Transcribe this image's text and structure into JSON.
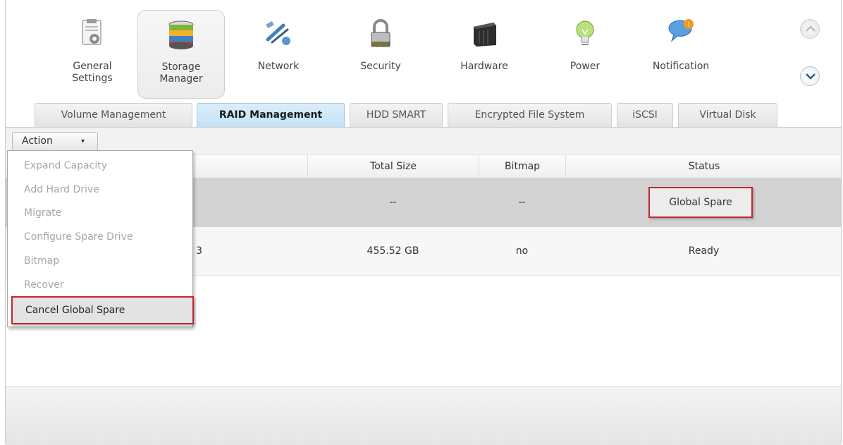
{
  "toolbar": {
    "items": [
      {
        "line1": "General",
        "line2": "Settings",
        "icon": "general-settings-icon"
      },
      {
        "line1": "Storage",
        "line2": "Manager",
        "icon": "storage-manager-icon"
      },
      {
        "line1": "Network",
        "line2": "",
        "icon": "network-icon"
      },
      {
        "line1": "Security",
        "line2": "",
        "icon": "security-lock-icon"
      },
      {
        "line1": "Hardware",
        "line2": "",
        "icon": "hardware-icon"
      },
      {
        "line1": "Power",
        "line2": "",
        "icon": "power-bulb-icon"
      },
      {
        "line1": "Notification",
        "line2": "",
        "icon": "notification-icon"
      }
    ],
    "active_index": 1
  },
  "tabs": [
    {
      "label": "Volume Management"
    },
    {
      "label": "RAID Management"
    },
    {
      "label": "HDD SMART"
    },
    {
      "label": "Encrypted File System"
    },
    {
      "label": "iSCSI"
    },
    {
      "label": "Virtual Disk"
    }
  ],
  "active_tab_index": 1,
  "action": {
    "label": "Action",
    "caret": "▾"
  },
  "table": {
    "headers": [
      "Total Size",
      "Bitmap",
      "Status"
    ],
    "rows": [
      {
        "name": "",
        "total_size": "--",
        "bitmap": "--",
        "status": "Global Spare"
      },
      {
        "name": "3",
        "total_size": "455.52 GB",
        "bitmap": "no",
        "status": "Ready"
      }
    ]
  },
  "menu": {
    "items": [
      {
        "label": "Expand Capacity",
        "enabled": false
      },
      {
        "label": "Add Hard Drive",
        "enabled": false
      },
      {
        "label": "Migrate",
        "enabled": false
      },
      {
        "label": "Configure Spare Drive",
        "enabled": false
      },
      {
        "label": "Bitmap",
        "enabled": false
      },
      {
        "label": "Recover",
        "enabled": false
      },
      {
        "label": "Cancel Global Spare",
        "enabled": true
      }
    ]
  },
  "colors": {
    "highlight_border": "#c0282d",
    "active_tab": "#c2e1f5",
    "selected_row": "#d2d2d2"
  }
}
